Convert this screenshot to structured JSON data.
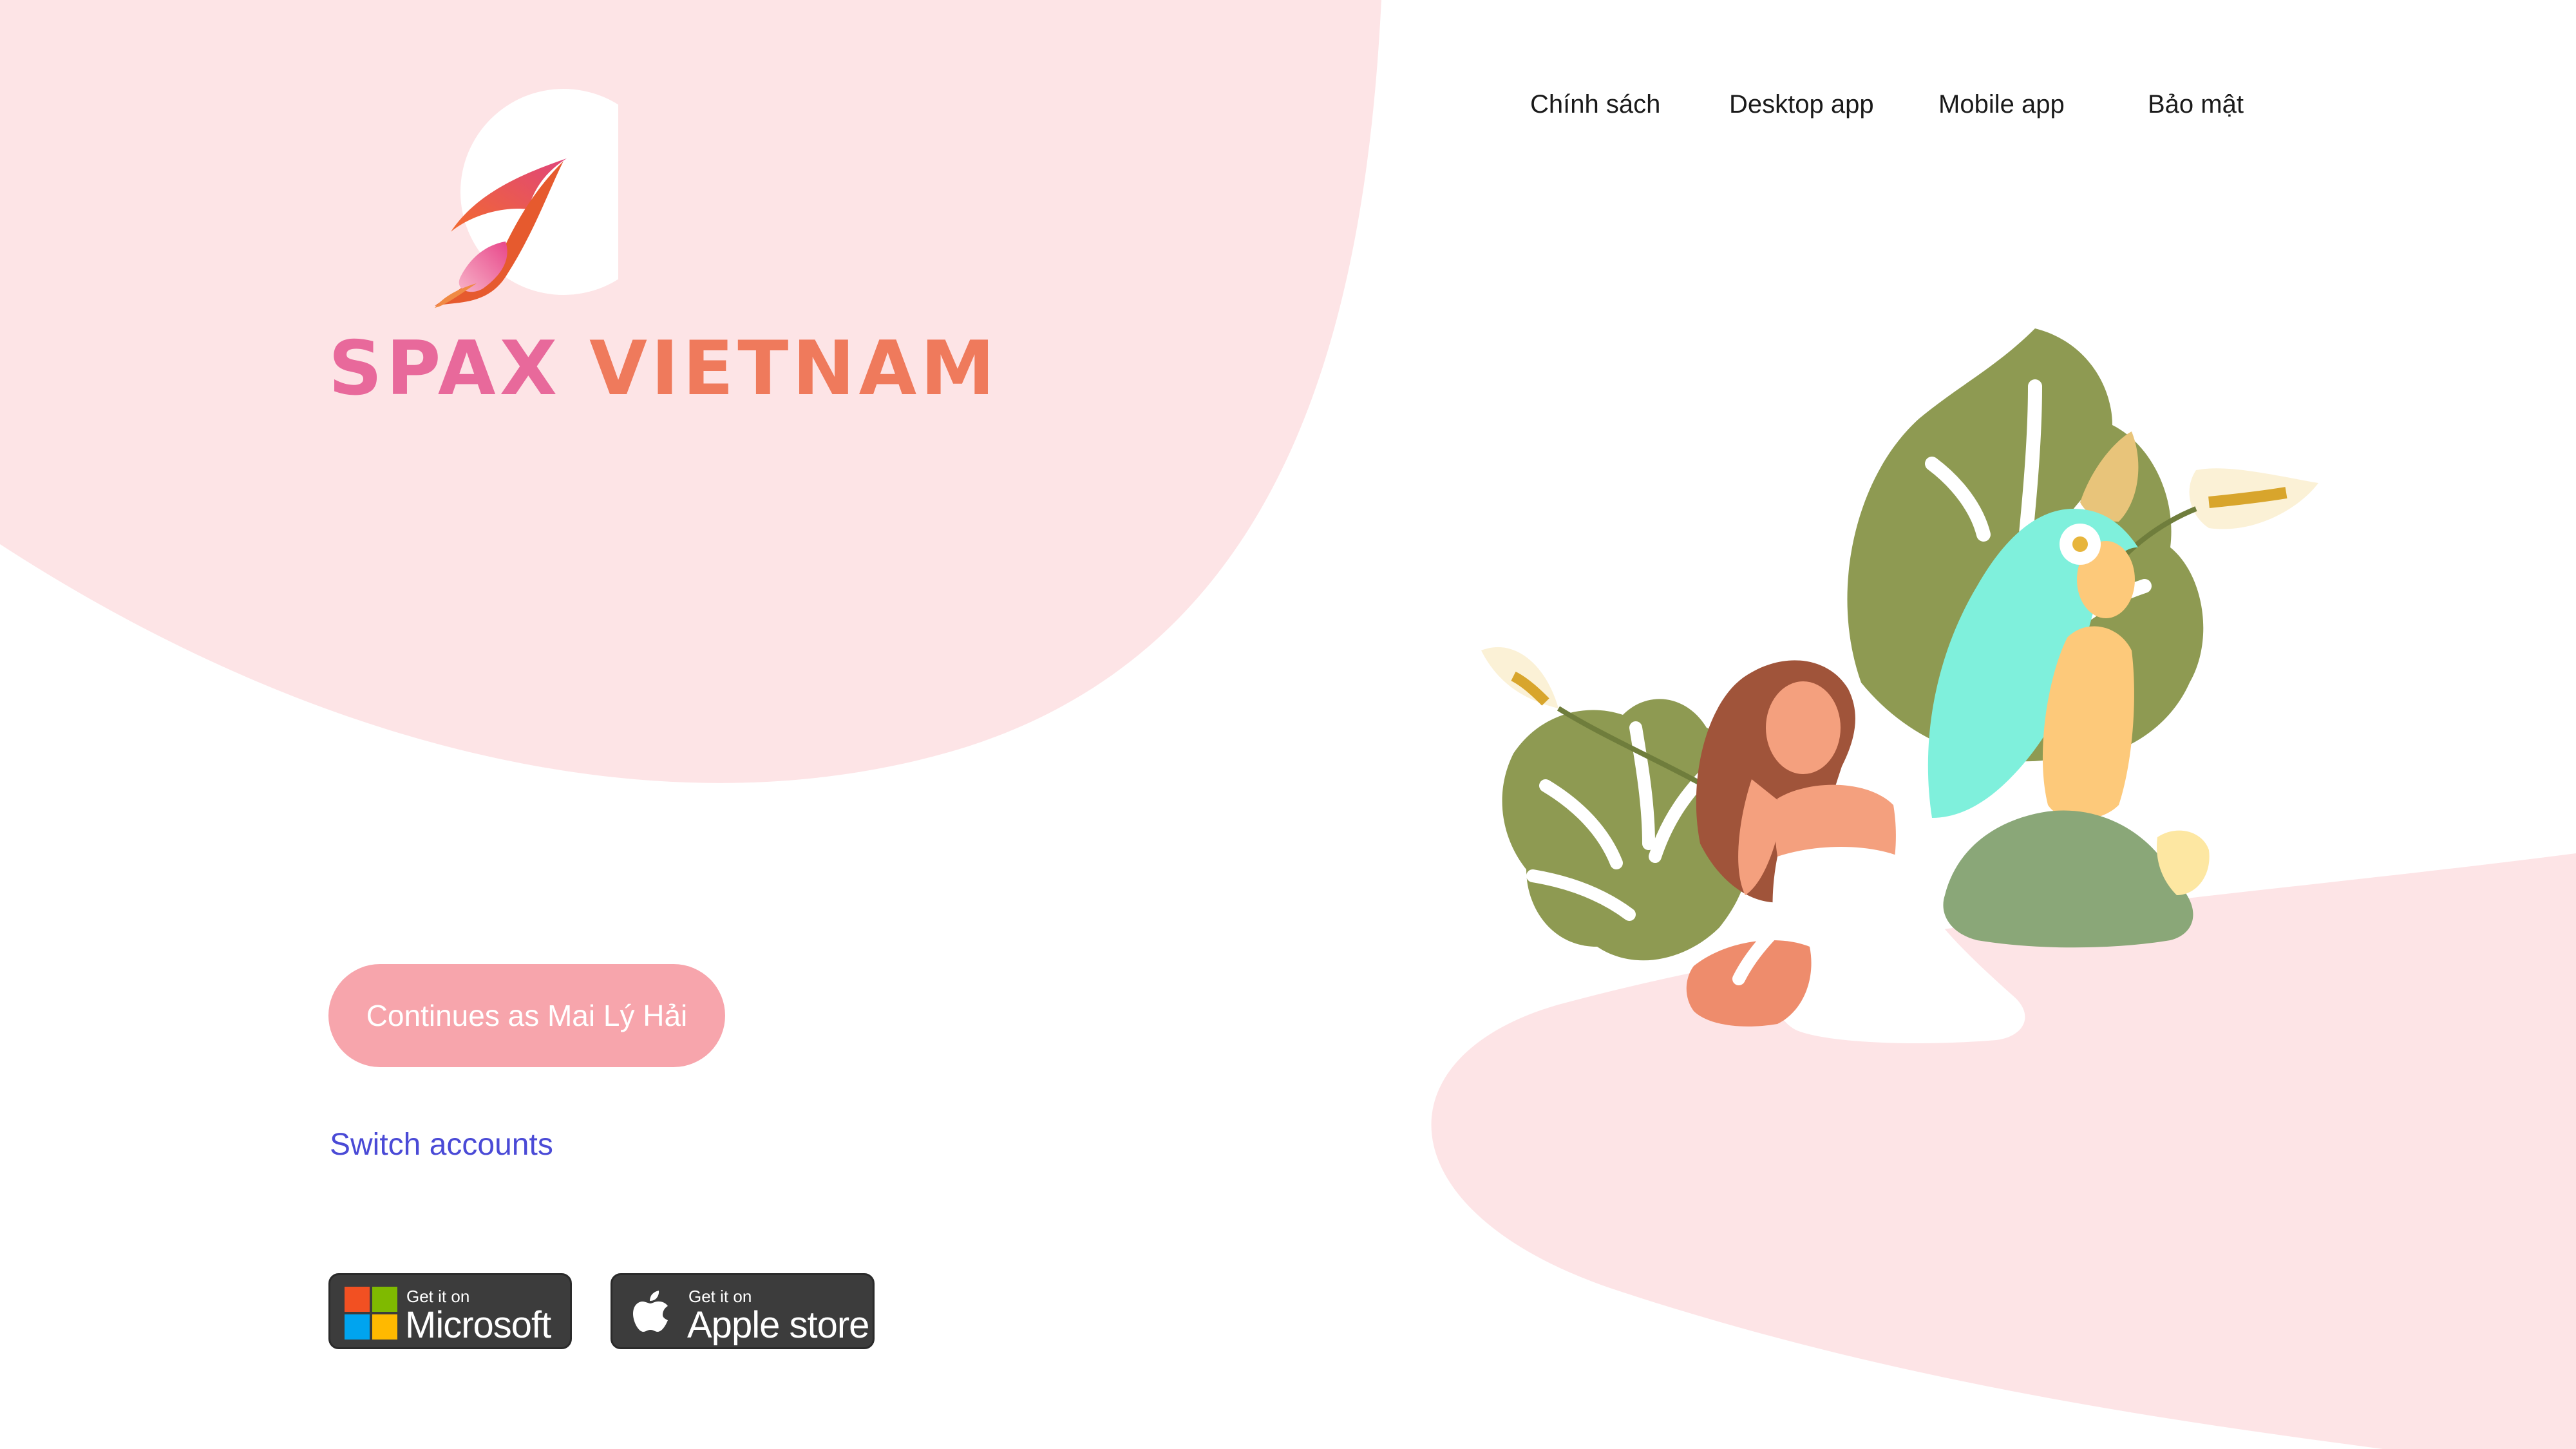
{
  "brand": {
    "name_part1": "SPAX",
    "name_part2": "VIETNAM",
    "logo_icon": "rocket-flame-logo"
  },
  "nav": {
    "items": [
      {
        "label": "Chính sách"
      },
      {
        "label": "Desktop app"
      },
      {
        "label": "Mobile app"
      },
      {
        "label": "Bảo mật"
      }
    ]
  },
  "login": {
    "continue_label": "Continues as Mai Lý Hải",
    "switch_label": "Switch accounts"
  },
  "stores": [
    {
      "small": "Get it on",
      "big": "Microsoft",
      "icon": "windows-logo-icon"
    },
    {
      "small": "Get it on",
      "big": "Apple store",
      "icon": "apple-logo-icon"
    }
  ],
  "colors": {
    "background": "#ffffff",
    "blob_pink": "#fde4e6",
    "button_pink": "#f7a5ac",
    "link_blue": "#4a4ad6",
    "brand_pink": "#e8699b",
    "brand_orange": "#ef7a5c"
  },
  "illustration": "two-women-relaxing-among-monstera-leaves"
}
